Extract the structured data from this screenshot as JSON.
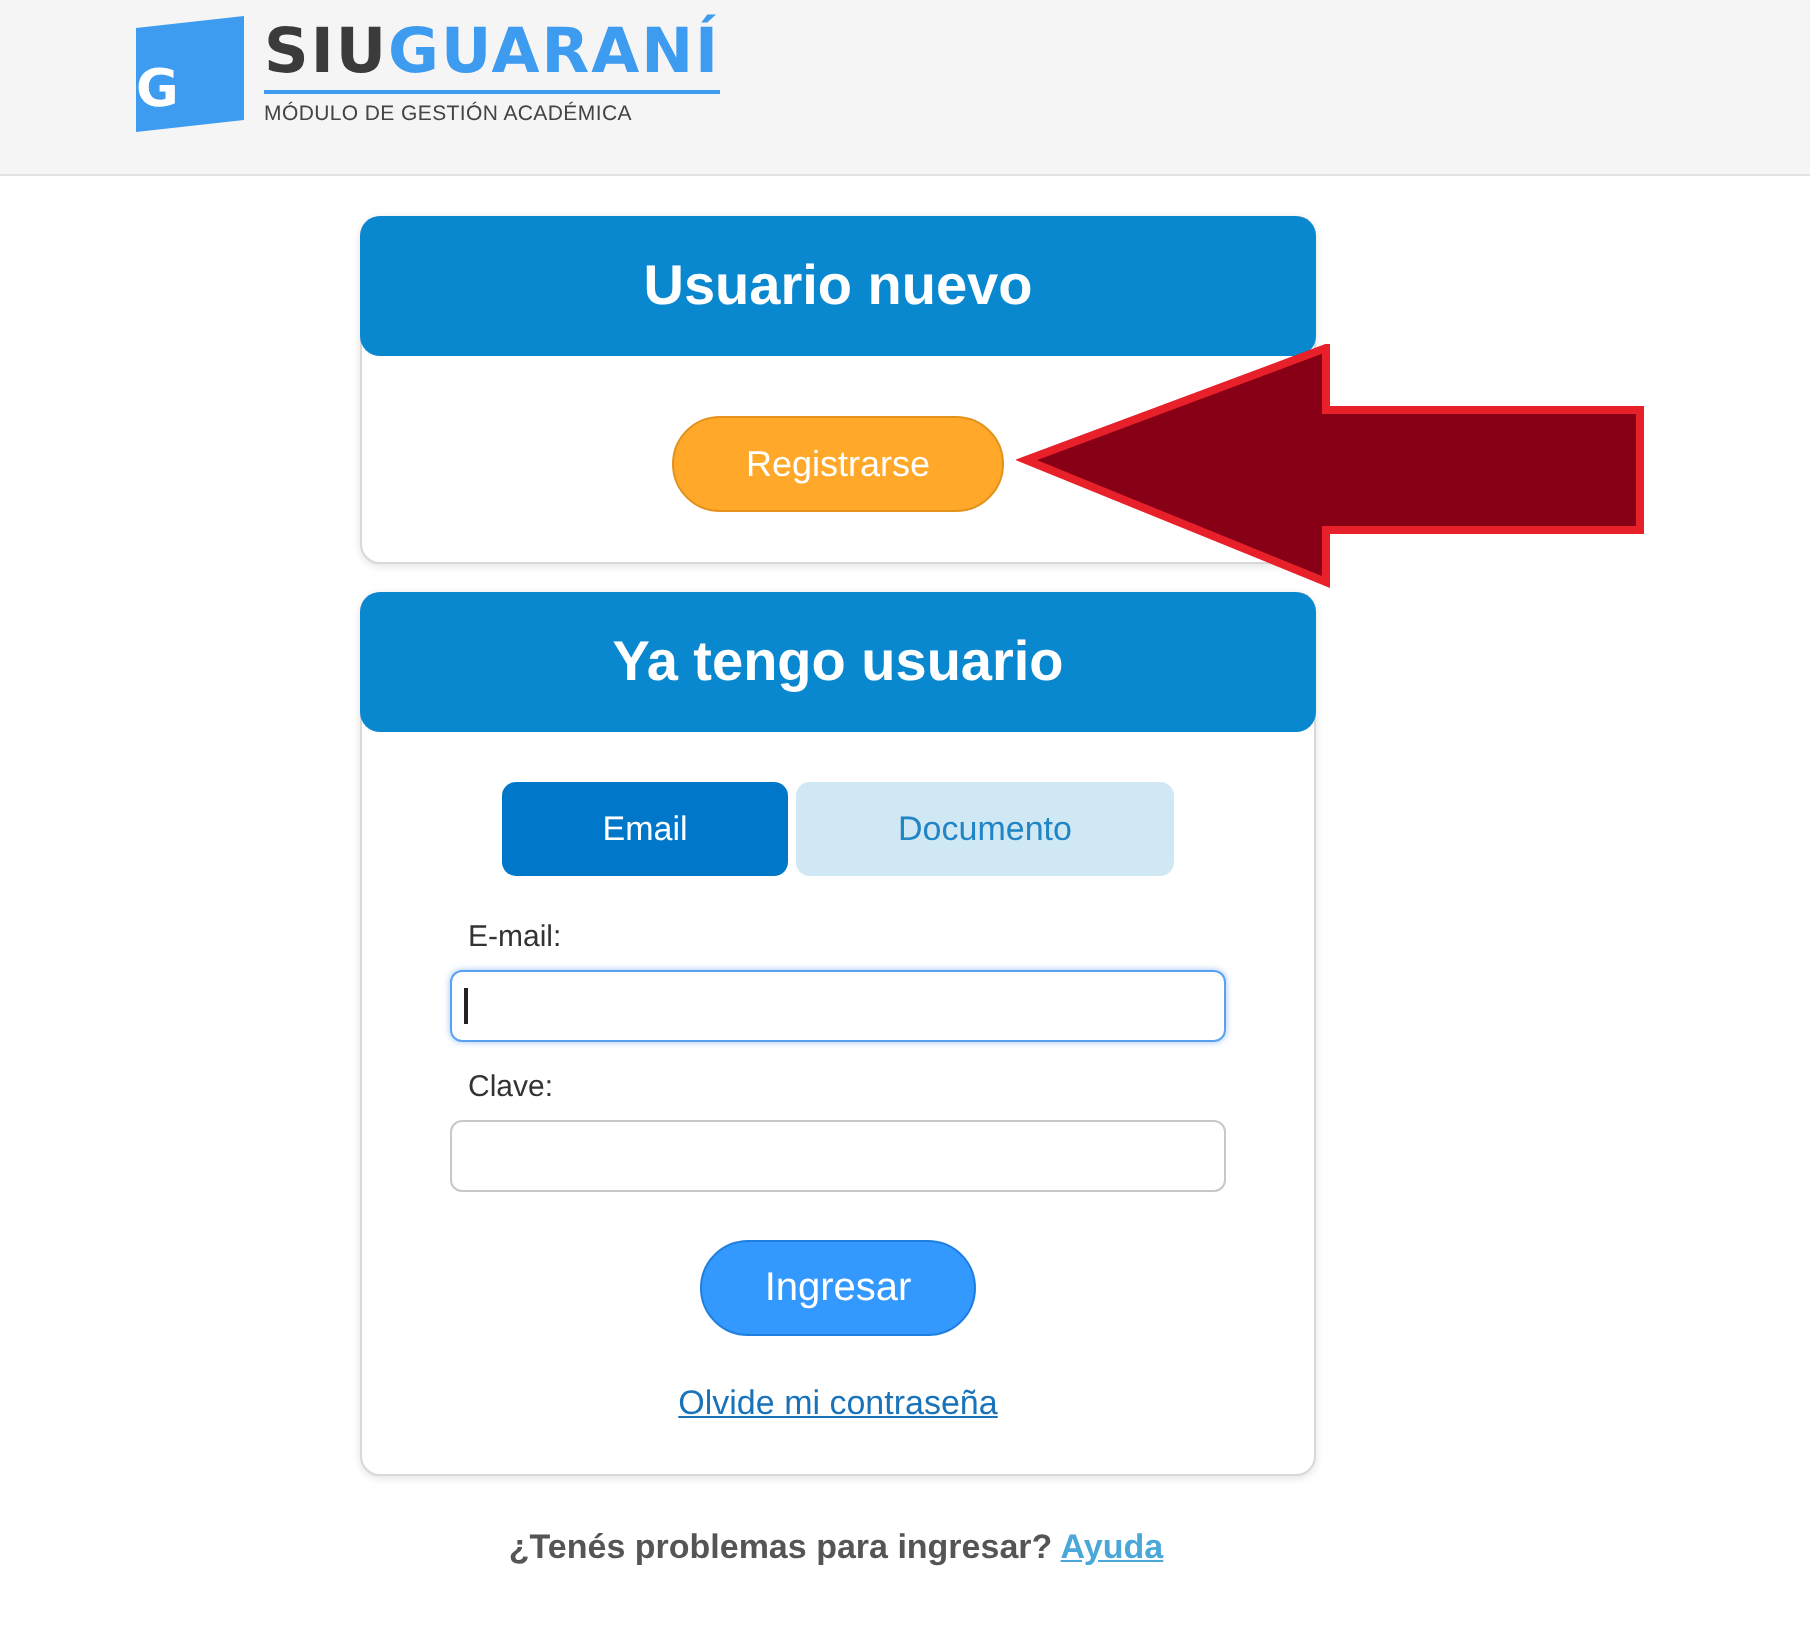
{
  "logo": {
    "icon_letter": "G",
    "brand_dark": "SIU",
    "brand_blue": "GUARANÍ",
    "subtitle": "MÓDULO DE GESTIÓN ACADÉMICA"
  },
  "new_user": {
    "title": "Usuario nuevo",
    "button": "Registrarse"
  },
  "annotation": {
    "kind": "arrow"
  },
  "login": {
    "title": "Ya tengo usuario",
    "tabs": [
      {
        "label": "Email",
        "selected": true
      },
      {
        "label": "Documento",
        "selected": false
      }
    ],
    "fields": [
      {
        "label": "E-mail:",
        "focused": true
      },
      {
        "label": "Clave:",
        "focused": false
      }
    ],
    "button": "Ingresar",
    "link": "Olvide mi contraseña"
  },
  "help": {
    "text": "¿Tenés problemas para ingresar?",
    "link": "Ayuda"
  }
}
